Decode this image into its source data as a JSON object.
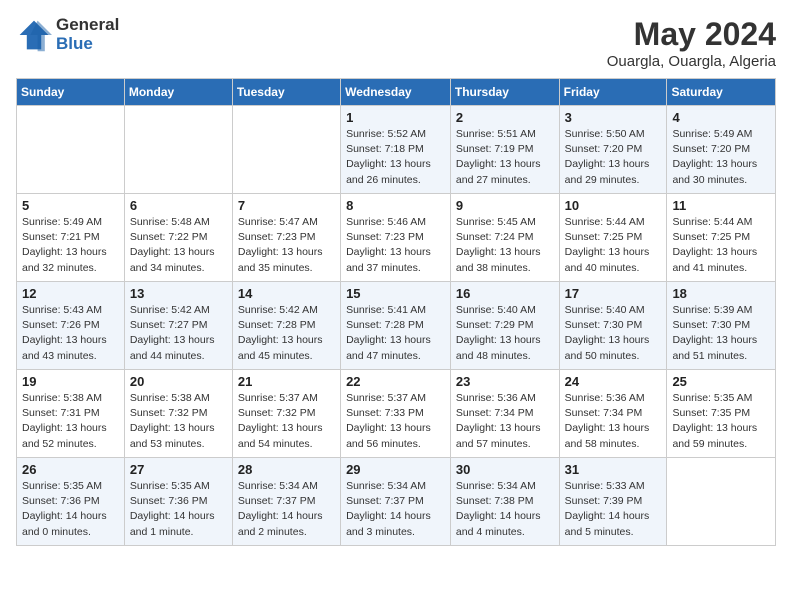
{
  "header": {
    "logo_general": "General",
    "logo_blue": "Blue",
    "month_year": "May 2024",
    "location": "Ouargla, Ouargla, Algeria"
  },
  "weekdays": [
    "Sunday",
    "Monday",
    "Tuesday",
    "Wednesday",
    "Thursday",
    "Friday",
    "Saturday"
  ],
  "weeks": [
    [
      {
        "day": "",
        "sunrise": "",
        "sunset": "",
        "daylight": ""
      },
      {
        "day": "",
        "sunrise": "",
        "sunset": "",
        "daylight": ""
      },
      {
        "day": "",
        "sunrise": "",
        "sunset": "",
        "daylight": ""
      },
      {
        "day": "1",
        "sunrise": "Sunrise: 5:52 AM",
        "sunset": "Sunset: 7:18 PM",
        "daylight": "Daylight: 13 hours and 26 minutes."
      },
      {
        "day": "2",
        "sunrise": "Sunrise: 5:51 AM",
        "sunset": "Sunset: 7:19 PM",
        "daylight": "Daylight: 13 hours and 27 minutes."
      },
      {
        "day": "3",
        "sunrise": "Sunrise: 5:50 AM",
        "sunset": "Sunset: 7:20 PM",
        "daylight": "Daylight: 13 hours and 29 minutes."
      },
      {
        "day": "4",
        "sunrise": "Sunrise: 5:49 AM",
        "sunset": "Sunset: 7:20 PM",
        "daylight": "Daylight: 13 hours and 30 minutes."
      }
    ],
    [
      {
        "day": "5",
        "sunrise": "Sunrise: 5:49 AM",
        "sunset": "Sunset: 7:21 PM",
        "daylight": "Daylight: 13 hours and 32 minutes."
      },
      {
        "day": "6",
        "sunrise": "Sunrise: 5:48 AM",
        "sunset": "Sunset: 7:22 PM",
        "daylight": "Daylight: 13 hours and 34 minutes."
      },
      {
        "day": "7",
        "sunrise": "Sunrise: 5:47 AM",
        "sunset": "Sunset: 7:23 PM",
        "daylight": "Daylight: 13 hours and 35 minutes."
      },
      {
        "day": "8",
        "sunrise": "Sunrise: 5:46 AM",
        "sunset": "Sunset: 7:23 PM",
        "daylight": "Daylight: 13 hours and 37 minutes."
      },
      {
        "day": "9",
        "sunrise": "Sunrise: 5:45 AM",
        "sunset": "Sunset: 7:24 PM",
        "daylight": "Daylight: 13 hours and 38 minutes."
      },
      {
        "day": "10",
        "sunrise": "Sunrise: 5:44 AM",
        "sunset": "Sunset: 7:25 PM",
        "daylight": "Daylight: 13 hours and 40 minutes."
      },
      {
        "day": "11",
        "sunrise": "Sunrise: 5:44 AM",
        "sunset": "Sunset: 7:25 PM",
        "daylight": "Daylight: 13 hours and 41 minutes."
      }
    ],
    [
      {
        "day": "12",
        "sunrise": "Sunrise: 5:43 AM",
        "sunset": "Sunset: 7:26 PM",
        "daylight": "Daylight: 13 hours and 43 minutes."
      },
      {
        "day": "13",
        "sunrise": "Sunrise: 5:42 AM",
        "sunset": "Sunset: 7:27 PM",
        "daylight": "Daylight: 13 hours and 44 minutes."
      },
      {
        "day": "14",
        "sunrise": "Sunrise: 5:42 AM",
        "sunset": "Sunset: 7:28 PM",
        "daylight": "Daylight: 13 hours and 45 minutes."
      },
      {
        "day": "15",
        "sunrise": "Sunrise: 5:41 AM",
        "sunset": "Sunset: 7:28 PM",
        "daylight": "Daylight: 13 hours and 47 minutes."
      },
      {
        "day": "16",
        "sunrise": "Sunrise: 5:40 AM",
        "sunset": "Sunset: 7:29 PM",
        "daylight": "Daylight: 13 hours and 48 minutes."
      },
      {
        "day": "17",
        "sunrise": "Sunrise: 5:40 AM",
        "sunset": "Sunset: 7:30 PM",
        "daylight": "Daylight: 13 hours and 50 minutes."
      },
      {
        "day": "18",
        "sunrise": "Sunrise: 5:39 AM",
        "sunset": "Sunset: 7:30 PM",
        "daylight": "Daylight: 13 hours and 51 minutes."
      }
    ],
    [
      {
        "day": "19",
        "sunrise": "Sunrise: 5:38 AM",
        "sunset": "Sunset: 7:31 PM",
        "daylight": "Daylight: 13 hours and 52 minutes."
      },
      {
        "day": "20",
        "sunrise": "Sunrise: 5:38 AM",
        "sunset": "Sunset: 7:32 PM",
        "daylight": "Daylight: 13 hours and 53 minutes."
      },
      {
        "day": "21",
        "sunrise": "Sunrise: 5:37 AM",
        "sunset": "Sunset: 7:32 PM",
        "daylight": "Daylight: 13 hours and 54 minutes."
      },
      {
        "day": "22",
        "sunrise": "Sunrise: 5:37 AM",
        "sunset": "Sunset: 7:33 PM",
        "daylight": "Daylight: 13 hours and 56 minutes."
      },
      {
        "day": "23",
        "sunrise": "Sunrise: 5:36 AM",
        "sunset": "Sunset: 7:34 PM",
        "daylight": "Daylight: 13 hours and 57 minutes."
      },
      {
        "day": "24",
        "sunrise": "Sunrise: 5:36 AM",
        "sunset": "Sunset: 7:34 PM",
        "daylight": "Daylight: 13 hours and 58 minutes."
      },
      {
        "day": "25",
        "sunrise": "Sunrise: 5:35 AM",
        "sunset": "Sunset: 7:35 PM",
        "daylight": "Daylight: 13 hours and 59 minutes."
      }
    ],
    [
      {
        "day": "26",
        "sunrise": "Sunrise: 5:35 AM",
        "sunset": "Sunset: 7:36 PM",
        "daylight": "Daylight: 14 hours and 0 minutes."
      },
      {
        "day": "27",
        "sunrise": "Sunrise: 5:35 AM",
        "sunset": "Sunset: 7:36 PM",
        "daylight": "Daylight: 14 hours and 1 minute."
      },
      {
        "day": "28",
        "sunrise": "Sunrise: 5:34 AM",
        "sunset": "Sunset: 7:37 PM",
        "daylight": "Daylight: 14 hours and 2 minutes."
      },
      {
        "day": "29",
        "sunrise": "Sunrise: 5:34 AM",
        "sunset": "Sunset: 7:37 PM",
        "daylight": "Daylight: 14 hours and 3 minutes."
      },
      {
        "day": "30",
        "sunrise": "Sunrise: 5:34 AM",
        "sunset": "Sunset: 7:38 PM",
        "daylight": "Daylight: 14 hours and 4 minutes."
      },
      {
        "day": "31",
        "sunrise": "Sunrise: 5:33 AM",
        "sunset": "Sunset: 7:39 PM",
        "daylight": "Daylight: 14 hours and 5 minutes."
      },
      {
        "day": "",
        "sunrise": "",
        "sunset": "",
        "daylight": ""
      }
    ]
  ]
}
